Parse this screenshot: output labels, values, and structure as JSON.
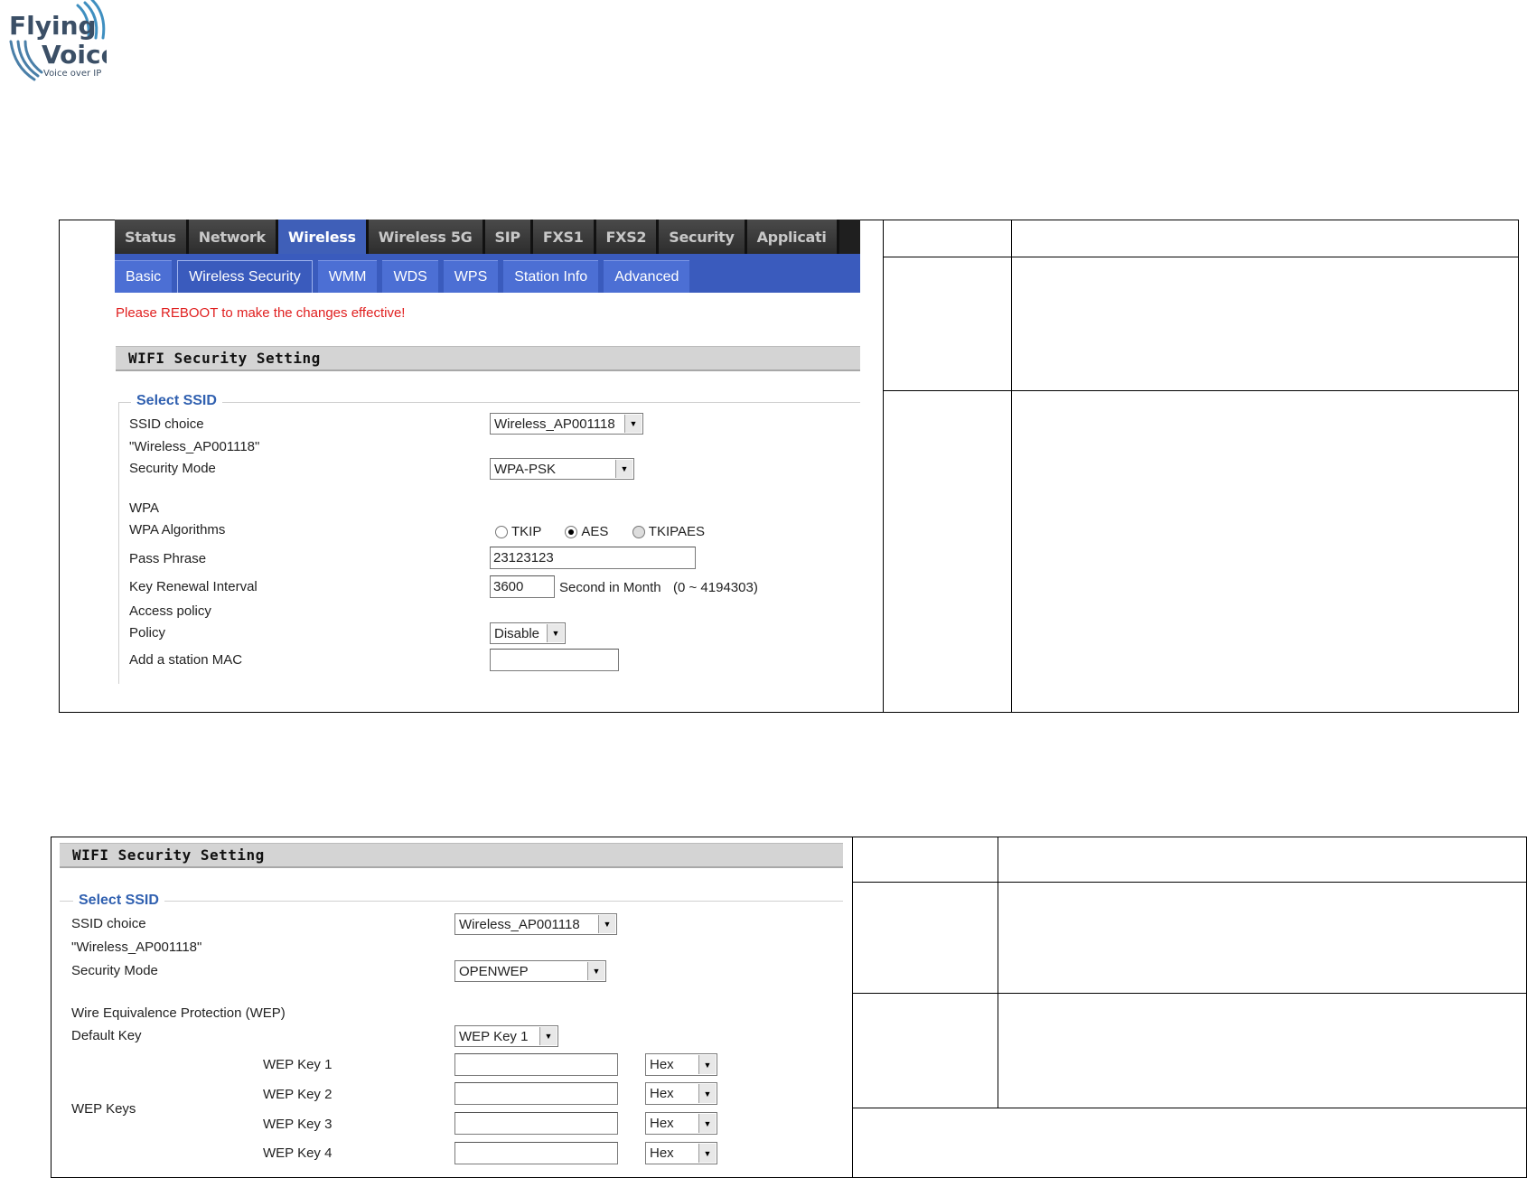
{
  "logo": {
    "line1": "Flying",
    "line2": "Voice",
    "tagline": "Voice over IP"
  },
  "panel1": {
    "top_tabs": [
      "Status",
      "Network",
      "Wireless",
      "Wireless 5G",
      "SIP",
      "FXS1",
      "FXS2",
      "Security",
      "Applicati"
    ],
    "active_top_tab": "Wireless",
    "sub_tabs": [
      "Basic",
      "Wireless Security",
      "WMM",
      "WDS",
      "WPS",
      "Station Info",
      "Advanced"
    ],
    "active_sub_tab": "Wireless Security",
    "reboot_notice": "Please REBOOT to make the changes effective!",
    "section_title": "WIFI Security Setting",
    "legend": "Select SSID",
    "ssid_choice_label": "SSID choice",
    "ssid_choice_value": "Wireless_AP001118",
    "ssid_quoted": "\"Wireless_AP001118\"",
    "security_mode_label": "Security Mode",
    "security_mode_value": "WPA-PSK",
    "wpa_heading": "WPA",
    "wpa_algorithms_label": "WPA Algorithms",
    "algorithms": [
      {
        "label": "TKIP",
        "checked": false,
        "disabled": false
      },
      {
        "label": "AES",
        "checked": true,
        "disabled": false
      },
      {
        "label": "TKIPAES",
        "checked": false,
        "disabled": true
      }
    ],
    "pass_phrase_label": "Pass Phrase",
    "pass_phrase_value": "23123123",
    "key_renewal_label": "Key Renewal Interval",
    "key_renewal_value": "3600",
    "key_renewal_unit": "Second in Month",
    "key_renewal_range": "(0 ~ 4194303)",
    "access_policy_label": "Access policy",
    "policy_label": "Policy",
    "policy_value": "Disable",
    "add_mac_label": "Add a station MAC",
    "add_mac_value": ""
  },
  "panel2": {
    "section_title": "WIFI Security Setting",
    "legend": "Select SSID",
    "ssid_choice_label": "SSID choice",
    "ssid_choice_value": "Wireless_AP001118",
    "ssid_quoted": "\"Wireless_AP001118\"",
    "security_mode_label": "Security Mode",
    "security_mode_value": "OPENWEP",
    "wep_heading": "Wire Equivalence Protection (WEP)",
    "default_key_label": "Default Key",
    "default_key_value": "WEP Key 1",
    "wep_keys_label": "WEP Keys",
    "wep_keys": [
      {
        "label": "WEP Key 1",
        "value": "",
        "format": "Hex"
      },
      {
        "label": "WEP Key 2",
        "value": "",
        "format": "Hex"
      },
      {
        "label": "WEP Key 3",
        "value": "",
        "format": "Hex"
      },
      {
        "label": "WEP Key 4",
        "value": "",
        "format": "Hex"
      }
    ]
  }
}
